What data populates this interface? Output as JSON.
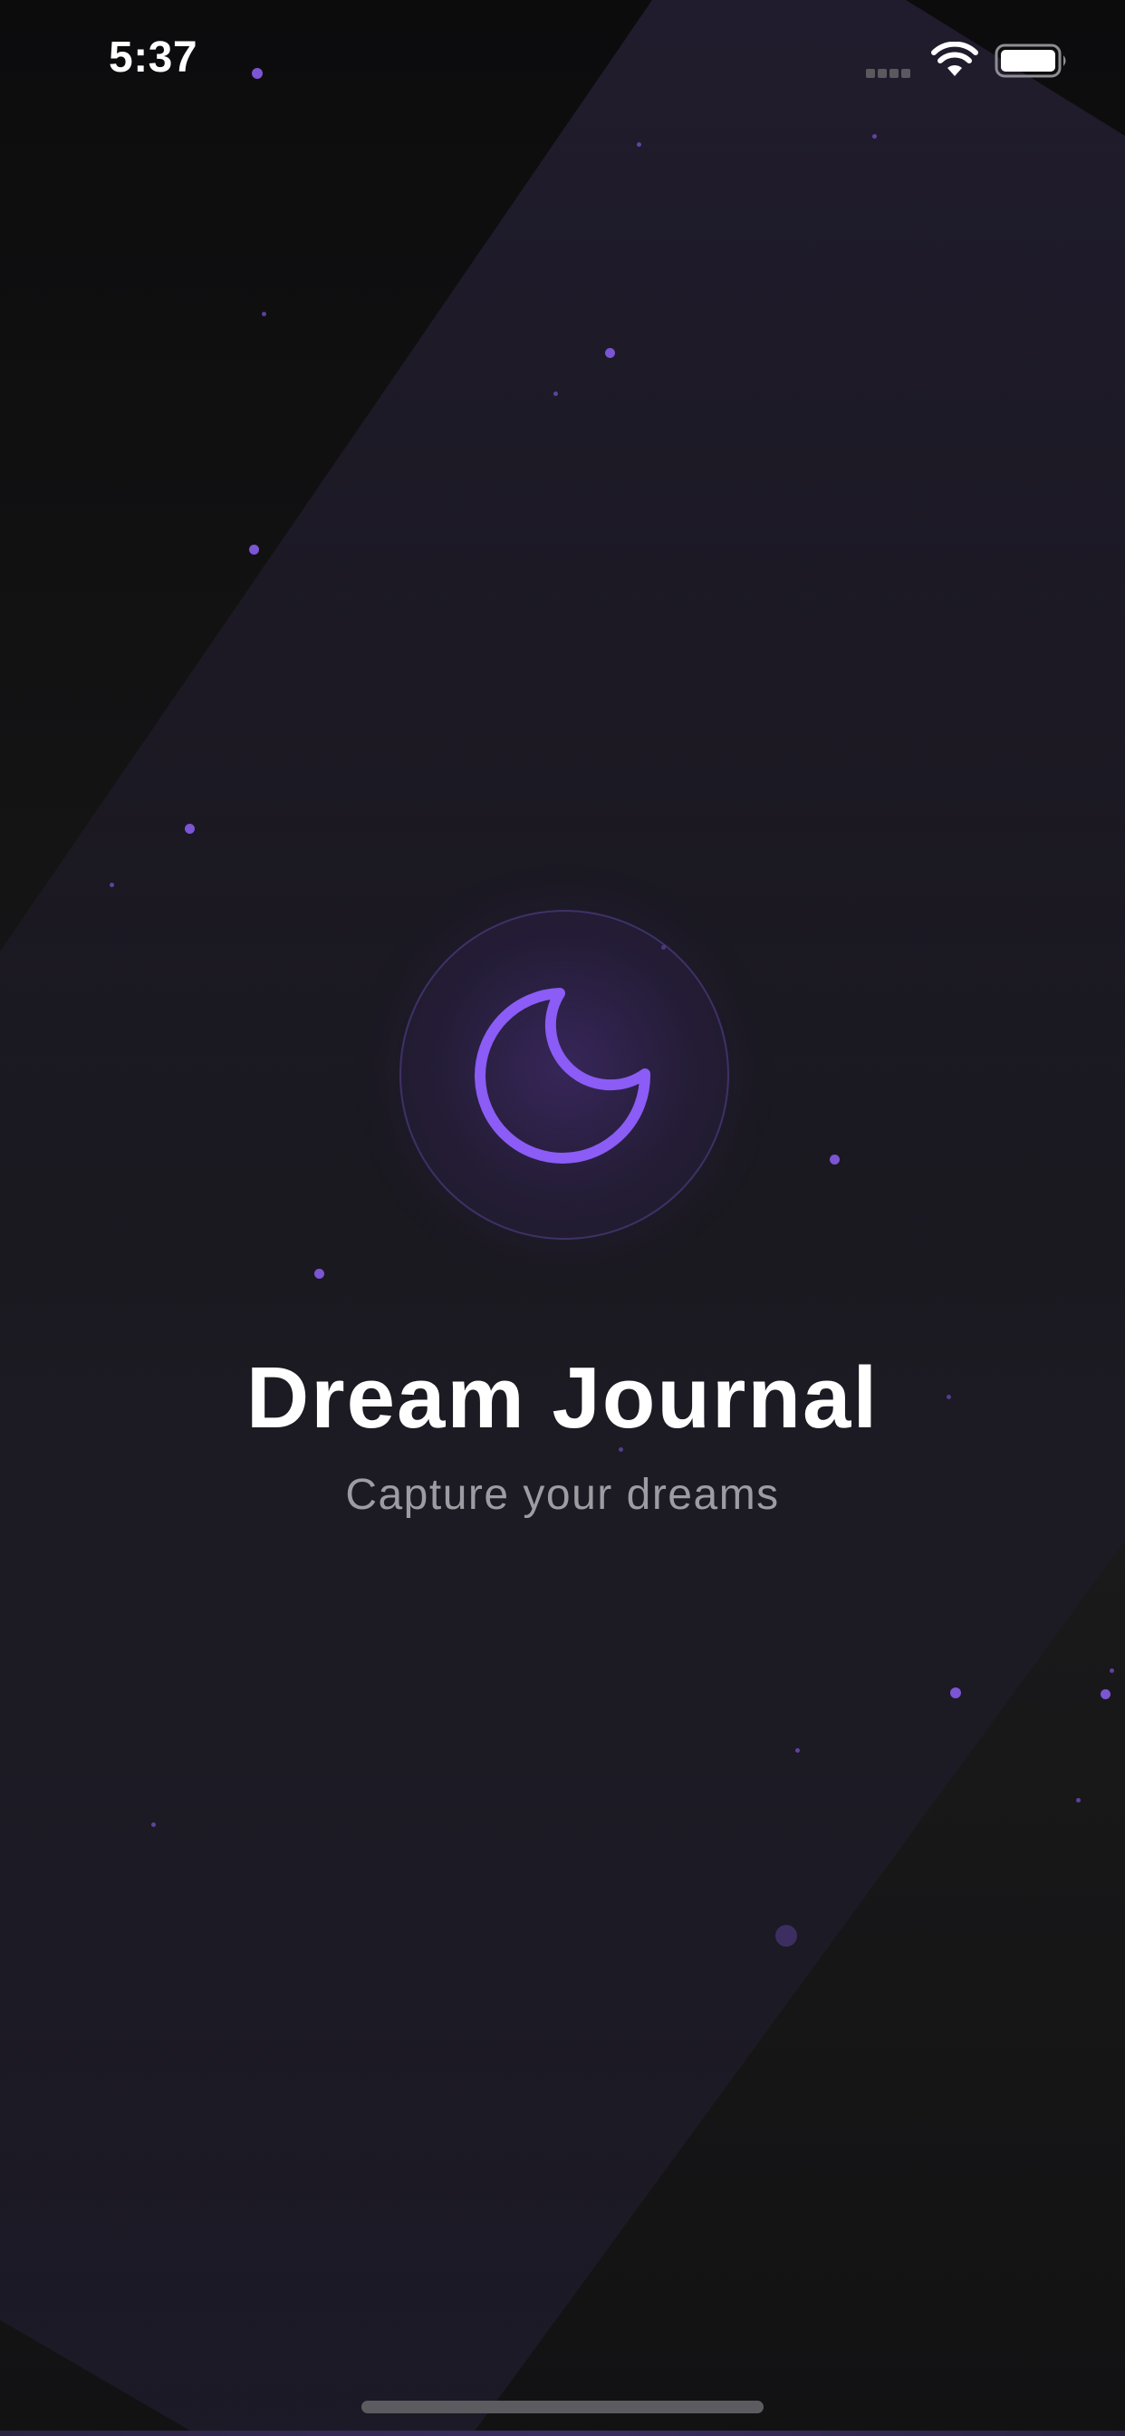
{
  "status_bar": {
    "time": "5:37"
  },
  "app": {
    "title": "Dream Journal",
    "subtitle": "Capture your dreams",
    "logo_icon": "moon-icon"
  },
  "colors": {
    "accent": "#8b5cf6",
    "background": "#161617",
    "title": "#ffffff",
    "subtitle": "#9c9ca2"
  }
}
